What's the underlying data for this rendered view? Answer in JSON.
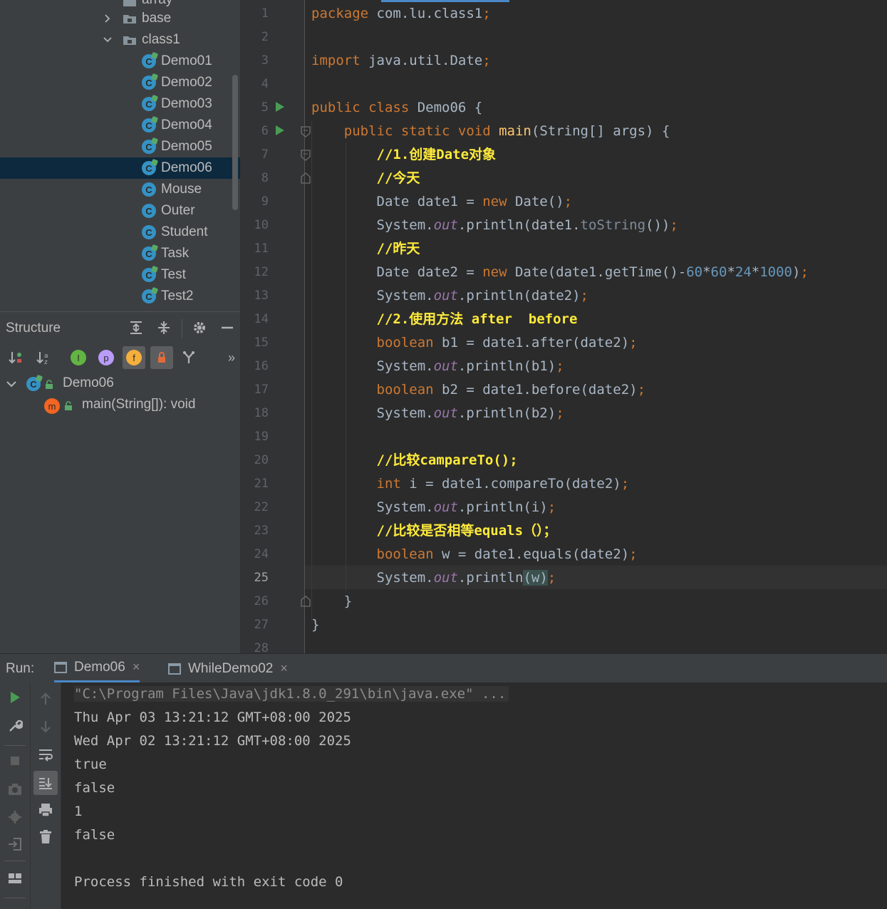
{
  "project_tree": {
    "partial_item": "array",
    "items": [
      {
        "label": "base",
        "type": "folder",
        "expanded": false
      },
      {
        "label": "class1",
        "type": "folder",
        "expanded": true
      },
      {
        "label": "Demo01",
        "type": "class",
        "runnable": true
      },
      {
        "label": "Demo02",
        "type": "class",
        "runnable": true
      },
      {
        "label": "Demo03",
        "type": "class",
        "runnable": true
      },
      {
        "label": "Demo04",
        "type": "class",
        "runnable": true
      },
      {
        "label": "Demo05",
        "type": "class",
        "runnable": true
      },
      {
        "label": "Demo06",
        "type": "class",
        "runnable": true,
        "selected": true
      },
      {
        "label": "Mouse",
        "type": "class",
        "runnable": false
      },
      {
        "label": "Outer",
        "type": "class",
        "runnable": false
      },
      {
        "label": "Student",
        "type": "class",
        "runnable": false
      },
      {
        "label": "Task",
        "type": "class",
        "runnable": true
      },
      {
        "label": "Test",
        "type": "class",
        "runnable": true
      },
      {
        "label": "Test2",
        "type": "class",
        "runnable": true
      }
    ]
  },
  "structure": {
    "title": "Structure",
    "class_node": "Demo06",
    "method_node": "main(String[]): void",
    "class_icon_letter": "C",
    "method_icon_letter": "m",
    "filter_letters": {
      "inherited": "I",
      "properties": "p",
      "fields": "f"
    },
    "more": "»"
  },
  "editor": {
    "current_line": 25,
    "lines": [
      {
        "n": "1",
        "tokens": [
          [
            "kw",
            "package "
          ],
          [
            "",
            "com.lu.class1"
          ],
          [
            "kw",
            ";"
          ]
        ]
      },
      {
        "n": "2",
        "tokens": []
      },
      {
        "n": "3",
        "tokens": [
          [
            "kw",
            "import "
          ],
          [
            "",
            "java.util.Date"
          ],
          [
            "kw",
            ";"
          ]
        ]
      },
      {
        "n": "4",
        "tokens": []
      },
      {
        "n": "5",
        "tokens": [
          [
            "kw",
            "public class "
          ],
          [
            "",
            "Demo06 {"
          ]
        ]
      },
      {
        "n": "6",
        "tokens": [
          [
            "",
            "    "
          ],
          [
            "kw",
            "public static void "
          ],
          [
            "mth",
            "main"
          ],
          [
            "",
            "(String[] args) {"
          ]
        ]
      },
      {
        "n": "7",
        "tokens": [
          [
            "",
            "        "
          ],
          [
            "cmt",
            "//1.创建Date对象"
          ]
        ]
      },
      {
        "n": "8",
        "tokens": [
          [
            "",
            "        "
          ],
          [
            "cmt",
            "//今天"
          ]
        ]
      },
      {
        "n": "9",
        "tokens": [
          [
            "",
            "        Date date1 = "
          ],
          [
            "kw",
            "new "
          ],
          [
            "",
            "Date()"
          ],
          [
            "kw",
            ";"
          ]
        ]
      },
      {
        "n": "10",
        "tokens": [
          [
            "",
            "        System."
          ],
          [
            "fld",
            "out"
          ],
          [
            "",
            ".println(date1."
          ],
          [
            "mth2",
            "toString"
          ],
          [
            "",
            "())"
          ],
          [
            "kw",
            ";"
          ]
        ]
      },
      {
        "n": "11",
        "tokens": [
          [
            "",
            "        "
          ],
          [
            "cmt",
            "//昨天"
          ]
        ]
      },
      {
        "n": "12",
        "tokens": [
          [
            "",
            "        Date date2 = "
          ],
          [
            "kw",
            "new "
          ],
          [
            "",
            "Date(date1.getTime()-"
          ],
          [
            "num",
            "60"
          ],
          [
            "",
            "*"
          ],
          [
            "num",
            "60"
          ],
          [
            "",
            "*"
          ],
          [
            "num",
            "24"
          ],
          [
            "",
            "*"
          ],
          [
            "num",
            "1000"
          ],
          [
            "",
            ")"
          ],
          [
            "kw",
            ";"
          ]
        ]
      },
      {
        "n": "13",
        "tokens": [
          [
            "",
            "        System."
          ],
          [
            "fld",
            "out"
          ],
          [
            "",
            ".println(date2)"
          ],
          [
            "kw",
            ";"
          ]
        ]
      },
      {
        "n": "14",
        "tokens": [
          [
            "",
            "        "
          ],
          [
            "cmt",
            "//2.使用方法 after  before"
          ]
        ]
      },
      {
        "n": "15",
        "tokens": [
          [
            "",
            "        "
          ],
          [
            "kw",
            "boolean "
          ],
          [
            "",
            "b1 = date1.after(date2)"
          ],
          [
            "kw",
            ";"
          ]
        ]
      },
      {
        "n": "16",
        "tokens": [
          [
            "",
            "        System."
          ],
          [
            "fld",
            "out"
          ],
          [
            "",
            ".println(b1)"
          ],
          [
            "kw",
            ";"
          ]
        ]
      },
      {
        "n": "17",
        "tokens": [
          [
            "",
            "        "
          ],
          [
            "kw",
            "boolean "
          ],
          [
            "",
            "b2 = date1.before(date2)"
          ],
          [
            "kw",
            ";"
          ]
        ]
      },
      {
        "n": "18",
        "tokens": [
          [
            "",
            "        System."
          ],
          [
            "fld",
            "out"
          ],
          [
            "",
            ".println(b2)"
          ],
          [
            "kw",
            ";"
          ]
        ]
      },
      {
        "n": "19",
        "tokens": []
      },
      {
        "n": "20",
        "tokens": [
          [
            "",
            "        "
          ],
          [
            "cmt",
            "//比较campareTo();"
          ]
        ]
      },
      {
        "n": "21",
        "tokens": [
          [
            "",
            "        "
          ],
          [
            "kw",
            "int "
          ],
          [
            "",
            "i = date1.compareTo(date2)"
          ],
          [
            "kw",
            ";"
          ]
        ]
      },
      {
        "n": "22",
        "tokens": [
          [
            "",
            "        System."
          ],
          [
            "fld",
            "out"
          ],
          [
            "",
            ".println(i)"
          ],
          [
            "kw",
            ";"
          ]
        ]
      },
      {
        "n": "23",
        "tokens": [
          [
            "",
            "        "
          ],
          [
            "cmt",
            "//比较是否相等equals（）；"
          ]
        ]
      },
      {
        "n": "24",
        "tokens": [
          [
            "",
            "        "
          ],
          [
            "kw",
            "boolean "
          ],
          [
            "",
            "w = date1.equals(date2)"
          ],
          [
            "kw",
            ";"
          ]
        ]
      },
      {
        "n": "25",
        "tokens": [
          [
            "",
            "        System."
          ],
          [
            "fld",
            "out"
          ],
          [
            "",
            ".println"
          ],
          [
            "hl",
            "(w)"
          ],
          [
            "kw",
            ";"
          ]
        ]
      },
      {
        "n": "26",
        "tokens": [
          [
            "",
            "    }"
          ]
        ]
      },
      {
        "n": "27",
        "tokens": [
          [
            "",
            "}"
          ]
        ]
      },
      {
        "n": "28",
        "tokens": []
      }
    ]
  },
  "run_panel": {
    "label": "Run:",
    "tabs": [
      {
        "label": "Demo06",
        "active": true,
        "close": "×"
      },
      {
        "label": "WhileDemo02",
        "active": false,
        "close": "×"
      }
    ],
    "output": [
      "\"C:\\Program Files\\Java\\jdk1.8.0_291\\bin\\java.exe\" ...",
      "Thu Apr 03 13:21:12 GMT+08:00 2025",
      "Wed Apr 02 13:21:12 GMT+08:00 2025",
      "true",
      "false",
      "1",
      "false",
      "",
      "Process finished with exit code 0"
    ]
  },
  "colors": {
    "keyword": "#cc7832",
    "comment": "#ffeb3b",
    "number": "#6897bb",
    "field": "#9876aa",
    "selection": "#0d293e",
    "run_green": "#499c54",
    "tab_accent": "#4a88c7"
  }
}
